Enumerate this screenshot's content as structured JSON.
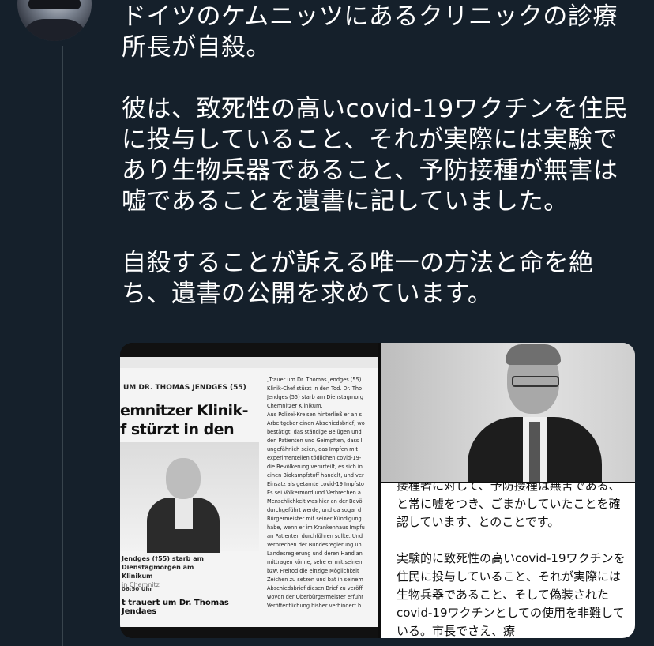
{
  "tweet": {
    "text": "ドイツのケムニッツにあるクリニックの診療\n所長が自殺。\n\n彼は、致死性の高いcovid-19ワクチンを住民\nに投与していること、それが実際には実験で\nあり生物兵器であること、予防接種が無害は\n嘘であることを遺書に記していました。\n\n自殺することが訴える唯一の方法と命を絶\nち、遺書の公開を求めています。"
  },
  "media": {
    "newspaper": {
      "section": "UM DR. THOMAS JENDGES (55)",
      "headline": "emnitzer Klinik-\nf stürzt in den Tod",
      "caption": "Jendges (†55) starb am Dienstagmorgen am\nKlinikum",
      "caption_sub": "in Chemnitz",
      "time": "06:50 Uhr",
      "subheadline": "t trauert um Dr. Thomas Jendaes",
      "column": "„Trauer um Dr. Thomas Jendges (55)\nKlinik-Chef stürzt in den Tod. Dr. Tho\nJendges (55) starb am Dienstagmorg\nChemnitzer Klinikum.\nAus Polizei-Kreisen hinterließ er an s\nArbeitgeber einen Abschiedsbrief, wo\nbestätigt, das ständige Belügen und\nden Patienten und Geimpften, dass I\nungefährlich seien, das Impfen mit\nexperimentellen tödlichen covid-19-\ndie Bevölkerung verurteilt, es sich in\neinen Biokampfstoff handelt, und ver\nEinsatz als getarnte covid-19 Impfsto\nEs sei Völkermord und Verbrechen a\nMenschlichkeit was hier an der Bevöl\ndurchgeführt werde, und da sogar d\nBürgermeister mit seiner Kündigung\nhabe, wenn er im Krankenhaus Impfu\nan Patienten durchführen sollte. Und\nVerbrechen der Bundesregierung un\nLandesregierung und deren Handlan\nmittragen könne, sehe er mit seinem\nbzw. Freitod die einzige Möglichkeit\nZeichen zu setzen und bat in seinem\nAbschiedsbrief diesen Brief zu veröff\nwovon der Oberbürgermeister erfuhr\nVeröffentlichung bisher verhindert h"
    },
    "translation": {
      "text": "接種者に対して、予防接種は無害である、と常に嘘をつき、ごまかしていたことを確認しています、とのことです。\n\n実験的に致死性の高いcovid-19ワクチンを住民に投与していること、それが実際には生物兵器であること、そして偽装されたcovid-19ワクチンとしての使用を非難している。市長でさえ、療"
    }
  }
}
